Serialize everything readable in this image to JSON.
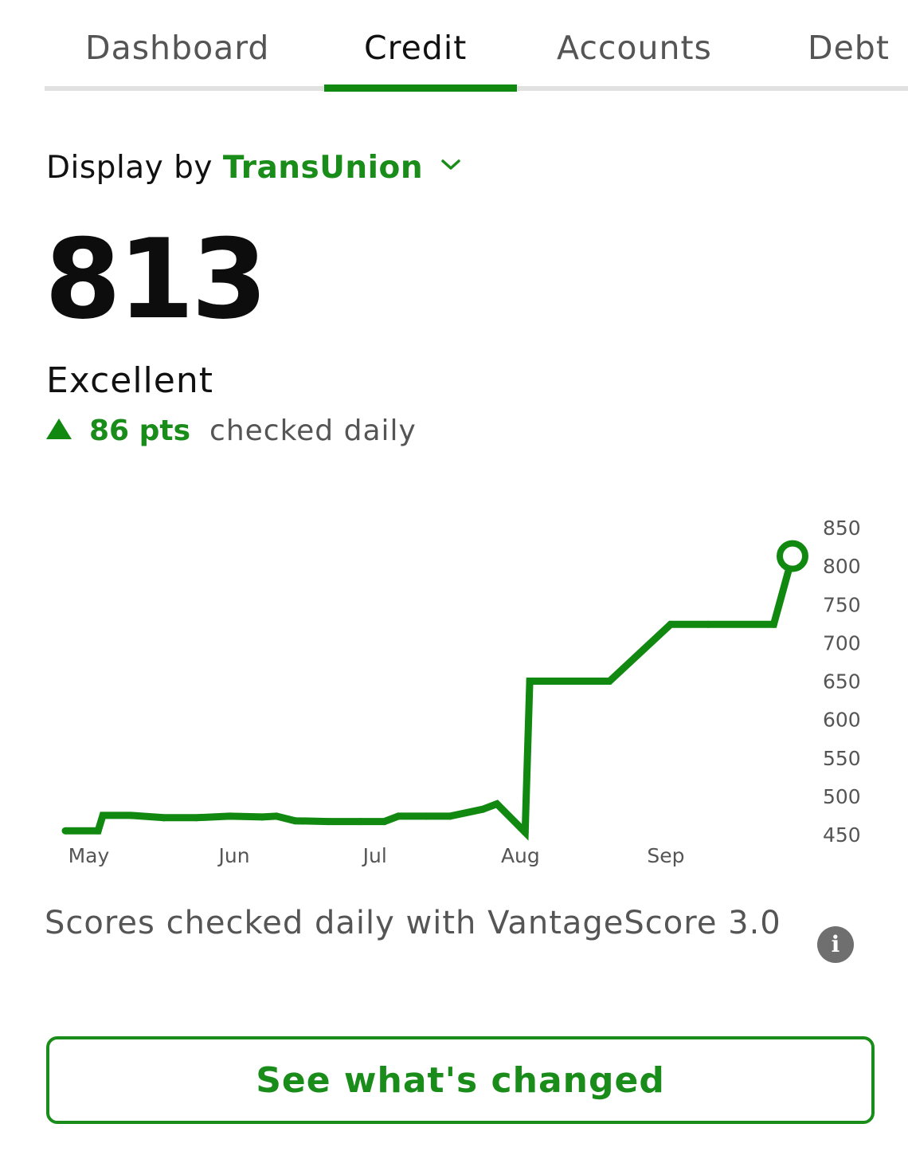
{
  "tabs": {
    "items": [
      "Dashboard",
      "Credit",
      "Accounts",
      "Debt"
    ],
    "active": "Credit"
  },
  "display_by": {
    "label": "Display by",
    "bureau": "TransUnion"
  },
  "score": {
    "value": "813",
    "rating": "Excellent",
    "change": "86 pts",
    "change_direction": "up",
    "frequency": "checked daily"
  },
  "colors": {
    "accent": "#1a8c1a",
    "line": "#118911",
    "text": "#111111",
    "muted": "#555555"
  },
  "chart_data": {
    "type": "line",
    "x_labels": [
      "May",
      "Jun",
      "Jul",
      "Aug",
      "Sep"
    ],
    "y_ticks": [
      850,
      800,
      750,
      700,
      650,
      600,
      550,
      500,
      450
    ],
    "ylim": [
      450,
      850
    ],
    "y_axis_side": "right",
    "grid": false,
    "current_marker": "hollow circle at latest point",
    "series": [
      {
        "points": [
          {
            "x": "2023-04-26",
            "y": 455
          },
          {
            "x": "2023-05-03",
            "y": 455
          },
          {
            "x": "2023-05-04",
            "y": 475
          },
          {
            "x": "2023-05-10",
            "y": 475
          },
          {
            "x": "2023-05-17",
            "y": 472
          },
          {
            "x": "2023-05-24",
            "y": 472
          },
          {
            "x": "2023-05-31",
            "y": 474
          },
          {
            "x": "2023-06-07",
            "y": 473
          },
          {
            "x": "2023-06-10",
            "y": 474
          },
          {
            "x": "2023-06-14",
            "y": 468
          },
          {
            "x": "2023-06-21",
            "y": 467
          },
          {
            "x": "2023-06-28",
            "y": 467
          },
          {
            "x": "2023-07-03",
            "y": 467
          },
          {
            "x": "2023-07-06",
            "y": 474
          },
          {
            "x": "2023-07-12",
            "y": 474
          },
          {
            "x": "2023-07-17",
            "y": 474
          },
          {
            "x": "2023-07-24",
            "y": 483
          },
          {
            "x": "2023-07-27",
            "y": 490
          },
          {
            "x": "2023-08-02",
            "y": 453
          },
          {
            "x": "2023-08-03",
            "y": 650
          },
          {
            "x": "2023-08-10",
            "y": 650
          },
          {
            "x": "2023-08-20",
            "y": 650
          },
          {
            "x": "2023-09-02",
            "y": 724
          },
          {
            "x": "2023-09-10",
            "y": 724
          },
          {
            "x": "2023-09-24",
            "y": 724
          },
          {
            "x": "2023-09-28",
            "y": 813
          }
        ]
      }
    ]
  },
  "footnote": "Scores checked daily with VantageScore 3.0",
  "info_icon_glyph": "i",
  "cta": {
    "label": "See what's changed"
  }
}
